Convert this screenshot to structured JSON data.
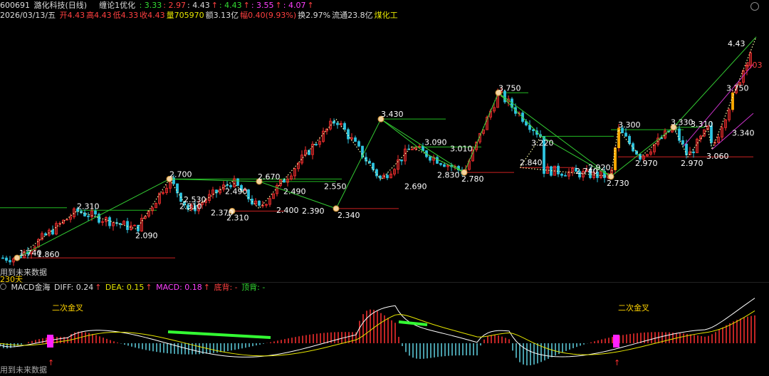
{
  "header": {
    "code": "600691",
    "name": "潞化科技(日线)",
    "indicator": "缠论1优化",
    "ind_values": [
      {
        "text": ": 3.33",
        "color": "g"
      },
      {
        "text": ": 2.97",
        "color": "r"
      },
      {
        "text": ": 4.43",
        "color": "w"
      },
      {
        "text": "↑",
        "color": "r"
      },
      {
        "text": ": 4.43",
        "color": "g"
      },
      {
        "text": "↑",
        "color": "r"
      },
      {
        "text": ": 3.55",
        "color": "m"
      },
      {
        "text": "↑",
        "color": "r"
      },
      {
        "text": ": 4.07",
        "color": "m"
      },
      {
        "text": "↑",
        "color": "r"
      }
    ],
    "date": "2026/03/13/五",
    "stats": [
      {
        "text": "开4.43",
        "color": "r"
      },
      {
        "text": "高4.43",
        "color": "r"
      },
      {
        "text": "低4.33",
        "color": "r"
      },
      {
        "text": "收4.43",
        "color": "r"
      },
      {
        "text": "量705970",
        "color": "y"
      },
      {
        "text": "额3.13亿",
        "color": "w"
      },
      {
        "text": "幅0.40(9.93%)",
        "color": "r"
      },
      {
        "text": "换2.97%",
        "color": "w"
      },
      {
        "text": "流通23.8亿",
        "color": "w"
      },
      {
        "text": "煤化工",
        "color": "y"
      }
    ]
  },
  "chart_data": {
    "type": "candlestick",
    "y_range": [
      1.55,
      4.55
    ],
    "key_points": [
      {
        "label": "1.740",
        "value": 1.74
      },
      {
        "label": "1.860",
        "value": 1.86
      },
      {
        "label": "2.310",
        "value": 2.31
      },
      {
        "label": "2.090",
        "value": 2.09
      },
      {
        "label": "2.700",
        "value": 2.7
      },
      {
        "label": "2.530",
        "value": 2.53
      },
      {
        "label": "2.310",
        "value": 2.31
      },
      {
        "label": "2.370",
        "value": 2.37
      },
      {
        "label": "2.490",
        "value": 2.49
      },
      {
        "label": "2.310",
        "value": 2.31
      },
      {
        "label": "2.670",
        "value": 2.67
      },
      {
        "label": "2.400",
        "value": 2.4
      },
      {
        "label": "2.490",
        "value": 2.49
      },
      {
        "label": "2.390",
        "value": 2.39
      },
      {
        "label": "2.550",
        "value": 2.55
      },
      {
        "label": "2.340",
        "value": 2.34
      },
      {
        "label": "3.430",
        "value": 3.43
      },
      {
        "label": "2.690",
        "value": 2.69
      },
      {
        "label": "3.090",
        "value": 3.09
      },
      {
        "label": "2.830",
        "value": 2.83
      },
      {
        "label": "3.010",
        "value": 3.01
      },
      {
        "label": "2.780",
        "value": 2.78
      },
      {
        "label": "3.750",
        "value": 3.75
      },
      {
        "label": "3.220",
        "value": 3.22
      },
      {
        "label": "2.840",
        "value": 2.84
      },
      {
        "label": "2.920",
        "value": 2.92
      },
      {
        "label": "2.740",
        "value": 2.74
      },
      {
        "label": "2.730",
        "value": 2.73
      },
      {
        "label": "3.300",
        "value": 3.3
      },
      {
        "label": "2.970",
        "value": 2.97
      },
      {
        "label": "3.330",
        "value": 3.33
      },
      {
        "label": "2.970",
        "value": 2.97
      },
      {
        "label": "3.310",
        "value": 3.31
      },
      {
        "label": "3.060",
        "value": 3.06
      },
      {
        "label": "3.750",
        "value": 3.75
      },
      {
        "label": "3.340",
        "value": 3.34
      },
      {
        "label": "4.03",
        "value": 4.03
      },
      {
        "label": "4.43",
        "value": 4.43
      }
    ],
    "zigzag": [
      1.74,
      2.31,
      2.09,
      2.7,
      2.31,
      2.67,
      2.34,
      3.43,
      2.69,
      3.09,
      2.78,
      3.75,
      3.22,
      2.84,
      2.73,
      3.3,
      2.97,
      3.33,
      2.97,
      3.31,
      3.06,
      4.43
    ],
    "colors": {
      "up": "#ff3030",
      "down": "#2ec4e0",
      "zigzag": "#33cc33",
      "dotted": "#ffffaa",
      "level_green": "#22bb22",
      "level_red": "#cc2222",
      "channel": "#cc33cc"
    }
  },
  "labels": {
    "partial_left_1": "用到未来数据",
    "partial_left_2": "230天",
    "macd_title": "MACD金海",
    "diff_label": "DIFF: 0.24",
    "diff_arrow": "↑",
    "dea_label": "DEA: 0.15",
    "dea_arrow": "↑",
    "macd_label": "MACD: 0.18",
    "macd_arrow": "↑",
    "bottom_div": "底背: -",
    "top_div": "顶背: -",
    "second_cross": "二次金叉",
    "future_data": "用到未来数据"
  }
}
